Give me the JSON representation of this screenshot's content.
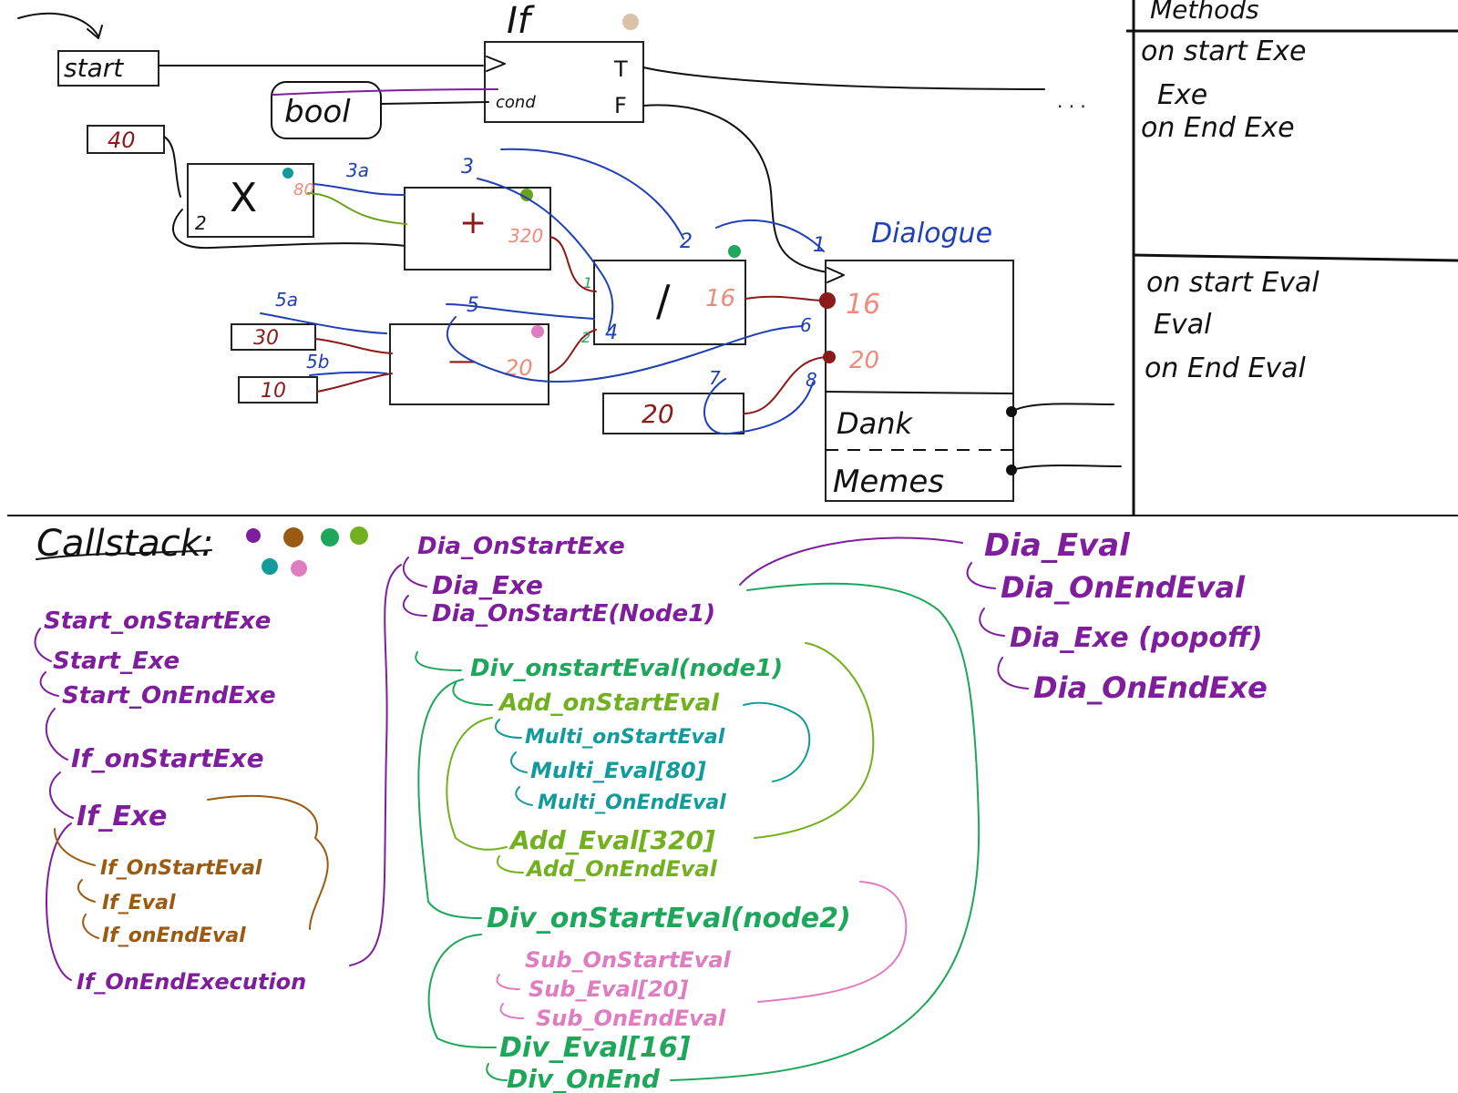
{
  "colors": {
    "ink": "#111111",
    "value_red": "#8b1a1a",
    "pin_salmon": "#f08a7a",
    "wire_blue": "#1f3fb5",
    "wire_green": "#6aa21e",
    "stack_purple": "#7e1e9c",
    "stack_brown": "#9a5a12",
    "stack_green": "#1ea65a",
    "stack_lime": "#73b020",
    "stack_teal": "#139a9a",
    "stack_pink": "#e07cc0",
    "dot_beige": "#d9c2a8"
  },
  "graph": {
    "start_label": "start",
    "if_title": "If",
    "if_cond": "cond",
    "if_true": "T",
    "if_false": "F",
    "bool_label": "bool",
    "ellipsis": ". . .",
    "const_40": "40",
    "const_30": "30",
    "const_10": "10",
    "const_20": "20",
    "mult_op": "X",
    "mult_in": "2",
    "mult_out": "80",
    "add_op": "+",
    "add_out": "320",
    "sub_op": "—",
    "sub_out": "20",
    "div_op": "/",
    "div_out": "16",
    "dialogue_title": "Dialogue",
    "dialogue_in1": "16",
    "dialogue_in2": "20",
    "dialogue_opt1": "Dank",
    "dialogue_opt2": "Memes"
  },
  "order_labels": {
    "l1": "1",
    "l2": "2",
    "l3": "3",
    "l3a": "3a",
    "l4": "4",
    "l5": "5",
    "l5a": "5a",
    "l5b": "5b",
    "l6": "6",
    "l7": "7",
    "l8": "8",
    "g1": "1",
    "g2": "2"
  },
  "methods_panel": {
    "title": "Methods",
    "exe_items": [
      "on start Exe",
      "Exe",
      "on End Exe"
    ],
    "eval_items": [
      "on start Eval",
      "Eval",
      "on End Eval"
    ]
  },
  "callstack": {
    "title": "Callstack:",
    "col1": [
      "Start_onStartExe",
      "Start_Exe",
      "Start_OnEndExe",
      "If_onStartExe",
      "If_Exe",
      "If_OnStartEval",
      "If_Eval",
      "If_onEndEval",
      "If_OnEndExecution"
    ],
    "col2_exe": [
      "Dia_OnStartExe",
      "Dia_Exe",
      "Dia_OnStartE(Node1)"
    ],
    "col2_eval": [
      "Div_onstartEval(node1)",
      "Add_onStartEval",
      "Multi_onStartEval",
      "Multi_Eval[80]",
      "Multi_OnEndEval",
      "Add_Eval[320]",
      "Add_OnEndEval",
      "Div_onStartEval(node2)",
      "Sub_OnStartEval",
      "Sub_Eval[20]",
      "Sub_OnEndEval",
      "Div_Eval[16]",
      "Div_OnEnd"
    ],
    "col3": [
      "Dia_Eval",
      "Dia_OnEndEval",
      "Dia_Exe (popoff)",
      "Dia_OnEndExe"
    ]
  }
}
